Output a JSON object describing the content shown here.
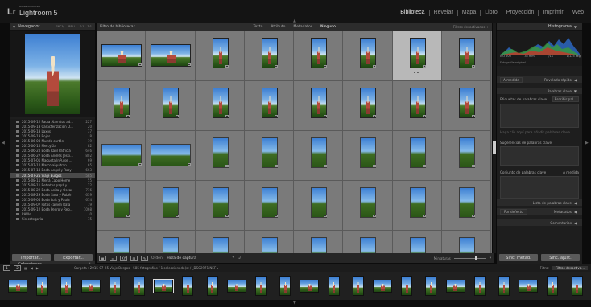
{
  "app": {
    "logo": "Lr",
    "edition": "Adobe Photoshop",
    "product": "Lightroom 5"
  },
  "modules": [
    "Biblioteca",
    "Revelar",
    "Mapa",
    "Libro",
    "Proyección",
    "Imprimir",
    "Web"
  ],
  "active_module": "Biblioteca",
  "navigator": {
    "title": "Navegador",
    "views": [
      "ENCAJ.",
      "RELL.",
      "1:1",
      "3:1"
    ]
  },
  "collections": {
    "title": "Colecciones",
    "items": [
      {
        "name": "2015-09-12 Paula Alamitos ad...",
        "count": "227"
      },
      {
        "name": "2015-09-13 Caracterización D...",
        "count": "20"
      },
      {
        "name": "2015-09-13 Laxos",
        "count": "37"
      },
      {
        "name": "2015-09-13 Rojos",
        "count": "8"
      },
      {
        "name": "2015-06-03 Mundo cartón",
        "count": "19"
      },
      {
        "name": "2015-06-10 MercyKia",
        "count": "82"
      },
      {
        "name": "2015-06-20 Boda Raúl Patricia",
        "count": "646"
      },
      {
        "name": "2015-06-27 Boda Andrés Jessi...",
        "count": "802"
      },
      {
        "name": "2015-07-01 Maqueta InPulse ...",
        "count": "69"
      },
      {
        "name": "2015-07-10 Marco aiquitrán",
        "count": "65"
      },
      {
        "name": "2015-07-18 Boda Ángel y Rosy",
        "count": "663"
      },
      {
        "name": "2015-07-25 Viaje Burgos",
        "count": "585"
      },
      {
        "name": "2015-08-11 Merlá Cabo Home",
        "count": "55"
      },
      {
        "name": "2015-08-11 Retratos papá y ...",
        "count": "22"
      },
      {
        "name": "2015-08-22 Boda Anita y Óscar",
        "count": "716"
      },
      {
        "name": "2015-08-29 Boda Sara y Rubén",
        "count": "639"
      },
      {
        "name": "2015-09-05 Boda Luis y Paula",
        "count": "674"
      },
      {
        "name": "2015-09-07 Fotos camen Rafa",
        "count": "19"
      },
      {
        "name": "2015-09-12 Boda Pedro y Reb...",
        "count": "1068"
      },
      {
        "name": "RAWs",
        "count": "0"
      },
      {
        "name": "Sin categoría",
        "count": "75"
      }
    ],
    "selected_index": 11
  },
  "buttons": {
    "import": "Importar...",
    "export": "Exportar...",
    "sync_metadata": "Sinc. metad.",
    "sync_settings": "Sinc. ajust."
  },
  "filter_bar": {
    "title": "Filtro de biblioteca :",
    "options": [
      "Texto",
      "Atributo",
      "Metadatos",
      "Ninguno"
    ],
    "active": "Ninguno",
    "preset": "Filtros desactivados ÷"
  },
  "grid": {
    "selected_index": 6,
    "cells": [
      "h",
      "h",
      "v",
      "v",
      "v",
      "v",
      "v",
      "v",
      "v",
      "v",
      "v",
      "v",
      "v",
      "v",
      "v",
      "v",
      "fh",
      "fh",
      "fv",
      "fv",
      "fv",
      "fv",
      "fv",
      "fv",
      "fv",
      "fv",
      "fv",
      "fv",
      "fv",
      "fv",
      "fv",
      "fv",
      "fv",
      "fv",
      "fv",
      "fv",
      "fv",
      "fv",
      "fv",
      "fv"
    ]
  },
  "toolbar": {
    "sort_label": "Orden:",
    "sort_value": "Hora de captura",
    "thumbs_label": "Miniaturas"
  },
  "right": {
    "histogram_title": "Histograma",
    "histo_vals": [
      "ISO 200",
      "35 mm",
      "f/11",
      "1/125 seg"
    ],
    "original_photo": "Fotografía original",
    "quick_develop": "Revelado rápido",
    "quick_preset": "A medida",
    "keywords_title": "Palabras clave",
    "keyword_tags_label": "Etiquetas de palabras clave",
    "keyword_tags_value": "Escribir pal...",
    "keyword_hint": "Haga clic aquí para añadir palabras clave",
    "suggestions": "Sugerencias de palabras clave",
    "keyword_set": "Conjunto de palabras clave",
    "keyword_set_value": "A medida",
    "keyword_list": "Lista de palabras clave",
    "metadata_title": "Metadatos",
    "metadata_preset": "Por defecto",
    "comments_title": "Comentarios"
  },
  "filmstrip": {
    "bar_num": "1",
    "bar_num2": "2",
    "path": "Carpeta : 2015-07-25 Viaje Burgos",
    "count": "585 fotografías / 1 seleccionada(s) / _DSC2971.NEF ▾",
    "filter_label": "Filtro:",
    "filter_value": "Filtros desactiva...",
    "selected_index": 6,
    "count_thumbs": 24
  },
  "colors": {
    "accent": "#e8e8e8",
    "panel": "#1e1e1e",
    "grid_bg": "#7a7a7a",
    "selected_cell": "#b8b8b8"
  }
}
